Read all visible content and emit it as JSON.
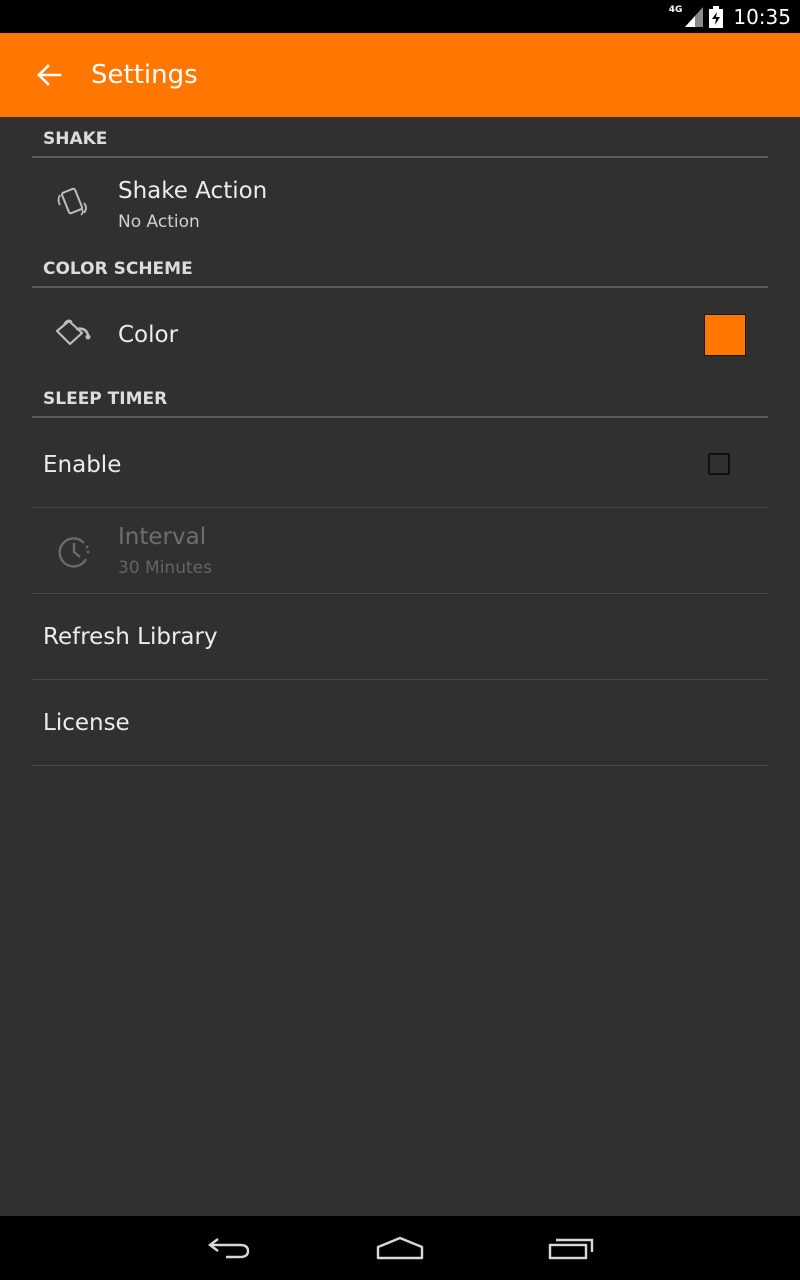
{
  "status_bar": {
    "network": "4G",
    "time": "10:35"
  },
  "toolbar": {
    "title": "Settings",
    "accent_color": "#ff7700"
  },
  "sections": {
    "shake": {
      "header": "SHAKE",
      "shake_action": {
        "title": "Shake Action",
        "summary": "No Action",
        "icon": "phone-shake-icon"
      }
    },
    "color_scheme": {
      "header": "COLOR SCHEME",
      "color": {
        "title": "Color",
        "icon": "paint-bucket-icon",
        "value": "#ff7700"
      }
    },
    "sleep_timer": {
      "header": "SLEEP TIMER",
      "enable": {
        "title": "Enable",
        "checked": false
      },
      "interval": {
        "title": "Interval",
        "summary": "30 Minutes",
        "icon": "clock-icon",
        "enabled": false
      }
    }
  },
  "refresh_library": {
    "title": "Refresh Library"
  },
  "license": {
    "title": "License"
  },
  "navbar": {
    "icons": [
      "back-icon",
      "home-icon",
      "recents-icon"
    ]
  }
}
